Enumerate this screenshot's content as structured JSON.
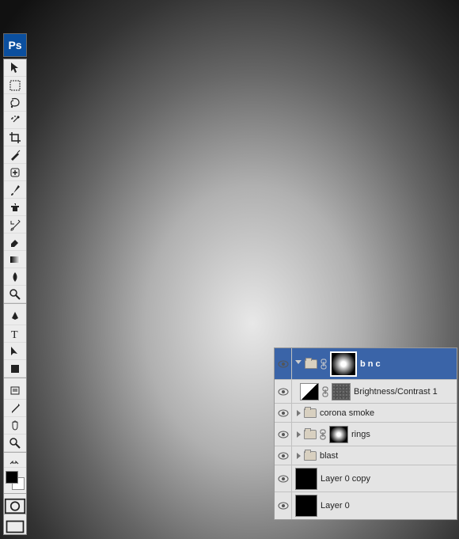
{
  "app": {
    "logo": "Ps"
  },
  "tools": [
    {
      "id": "move-tool"
    },
    {
      "id": "marquee-tool"
    },
    {
      "id": "lasso-tool"
    },
    {
      "id": "magic-wand-tool"
    },
    {
      "id": "crop-tool"
    },
    {
      "id": "slice-tool"
    },
    {
      "id": "healing-brush-tool"
    },
    {
      "id": "brush-tool"
    },
    {
      "id": "clone-stamp-tool"
    },
    {
      "id": "history-brush-tool"
    },
    {
      "id": "eraser-tool"
    },
    {
      "id": "gradient-tool"
    },
    {
      "id": "blur-tool"
    },
    {
      "id": "dodge-tool"
    },
    {
      "id": "pen-tool"
    },
    {
      "id": "type-tool"
    },
    {
      "id": "path-selection-tool"
    },
    {
      "id": "shape-tool"
    },
    {
      "id": "notes-tool"
    },
    {
      "id": "eyedropper-tool"
    },
    {
      "id": "hand-tool"
    },
    {
      "id": "zoom-tool"
    }
  ],
  "layers": [
    {
      "name": "b n c",
      "type": "group",
      "selected": true,
      "expanded": true,
      "linked": true,
      "mask": "radial"
    },
    {
      "name": "Brightness/Contrast 1",
      "type": "adjustment",
      "linked": true,
      "mask": "noise"
    },
    {
      "name": "corona smoke",
      "type": "group",
      "expanded": false
    },
    {
      "name": "rings",
      "type": "group",
      "expanded": false,
      "linked": true,
      "mask": "radial"
    },
    {
      "name": "blast",
      "type": "group",
      "expanded": false
    },
    {
      "name": "Layer 0 copy",
      "type": "raster",
      "thumb": "black"
    },
    {
      "name": "Layer 0",
      "type": "raster",
      "thumb": "black"
    }
  ]
}
